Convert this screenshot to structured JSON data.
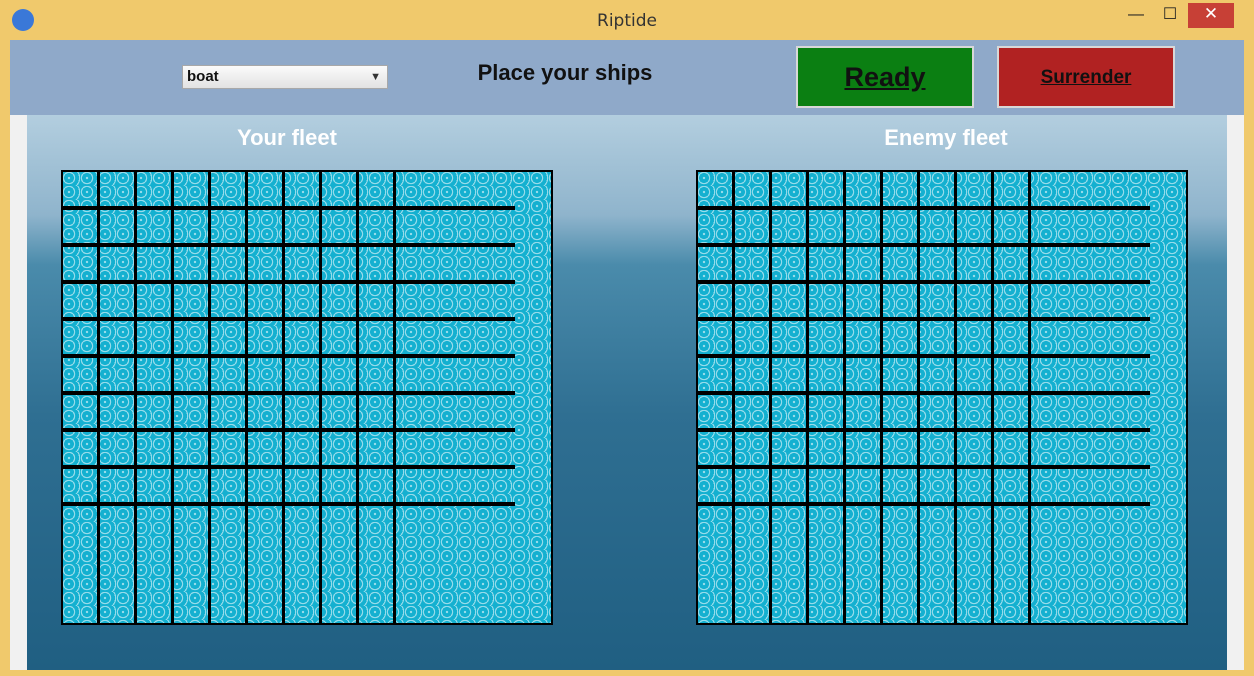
{
  "window": {
    "title": "Riptide",
    "minimize": "—",
    "maximize": "☐",
    "close": "✕"
  },
  "toolbar": {
    "ship_select_value": "boat",
    "instruction": "Place your ships",
    "ready_label": "Ready",
    "surrender_label": "Surrender"
  },
  "boards": {
    "player_title": "Your fleet",
    "enemy_title": "Enemy fleet"
  },
  "colors": {
    "water": "#14b0d0",
    "ready": "#0b7f12",
    "surrender": "#b12222"
  }
}
